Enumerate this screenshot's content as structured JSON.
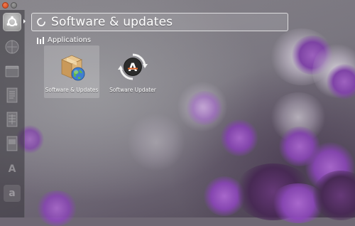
{
  "window": {
    "close_icon": "close-icon",
    "maximize_icon": "maximize-icon"
  },
  "launcher": {
    "home_icon": "ubuntu-logo-icon",
    "items": [
      {
        "icon": "web-browser-icon"
      },
      {
        "icon": "files-icon"
      },
      {
        "icon": "text-document-icon"
      },
      {
        "icon": "spreadsheet-icon"
      },
      {
        "icon": "presentation-icon"
      },
      {
        "icon": "software-center-icon",
        "glyph": "A"
      },
      {
        "icon": "amazon-icon",
        "glyph": "a"
      }
    ]
  },
  "search": {
    "query": "Software & updates",
    "icon": "spinner-icon"
  },
  "results": {
    "category_label": "Applications",
    "category_icon": "applications-icon",
    "items": [
      {
        "label": "Software & Updates",
        "icon": "software-properties-icon",
        "selected": true
      },
      {
        "label": "Software Updater",
        "icon": "software-updater-icon",
        "selected": false
      }
    ]
  },
  "colors": {
    "close_button": "#d2481f",
    "wallpaper_accent": "#8c48b9",
    "search_border": "#ffffff"
  }
}
